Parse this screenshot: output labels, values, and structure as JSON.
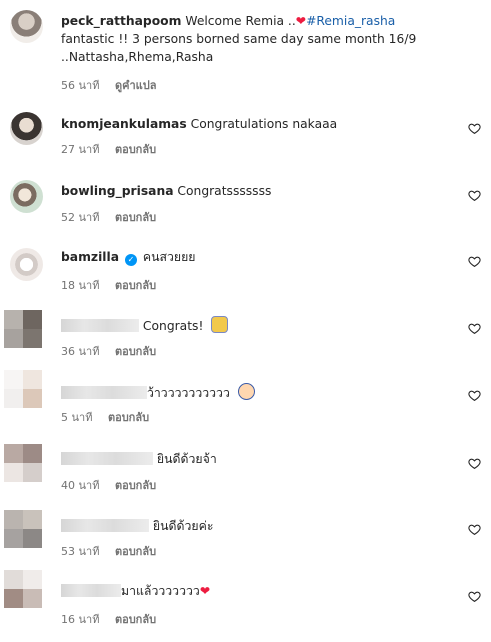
{
  "comments": [
    {
      "username": "peck_ratthapoom",
      "text_before": "Welcome Remia ..",
      "heart": "❤",
      "hashtag": "#Remia_rasha",
      "text_after": "fantastic !! 3 persons borned same day same month 16/9 ..Nattasha,Rhema,Rasha",
      "time": "56 นาที",
      "action": "ดูคำแปล"
    },
    {
      "username": "knomjeankulamas",
      "text": "Congratulations nakaaa",
      "time": "27 นาที",
      "action": "ตอบกลับ"
    },
    {
      "username": "bowling_prisana",
      "text": "Congratsssssss",
      "time": "52 นาที",
      "action": "ตอบกลับ"
    },
    {
      "username": "bamzilla",
      "verified": "✓",
      "text": "คนสวยยย",
      "time": "18 นาที",
      "action": "ตอบกลับ"
    },
    {
      "text": "Congrats!",
      "emoji": "raised-fists-emoji",
      "time": "36 นาที",
      "action": "ตอบกลับ"
    },
    {
      "text": "ว้าวววววววววว",
      "emoji": "police-face-emoji",
      "time": "5 นาที",
      "action": "ตอบกลับ"
    },
    {
      "text": "ยินดีด้วยจ้า",
      "time": "40 นาที",
      "action": "ตอบกลับ"
    },
    {
      "text": "ยินดีด้วยค่ะ",
      "time": "53 นาที",
      "action": "ตอบกลับ"
    },
    {
      "text": "มาแล้ววววววว",
      "heart": "❤",
      "time": "16 นาที",
      "action": "ตอบกลับ"
    }
  ],
  "icons": {
    "like": "heart-outline-icon"
  },
  "colors": {
    "hashtag": "#1a5fa8",
    "verified": "#0095f6",
    "heart": "#ed1c40"
  }
}
